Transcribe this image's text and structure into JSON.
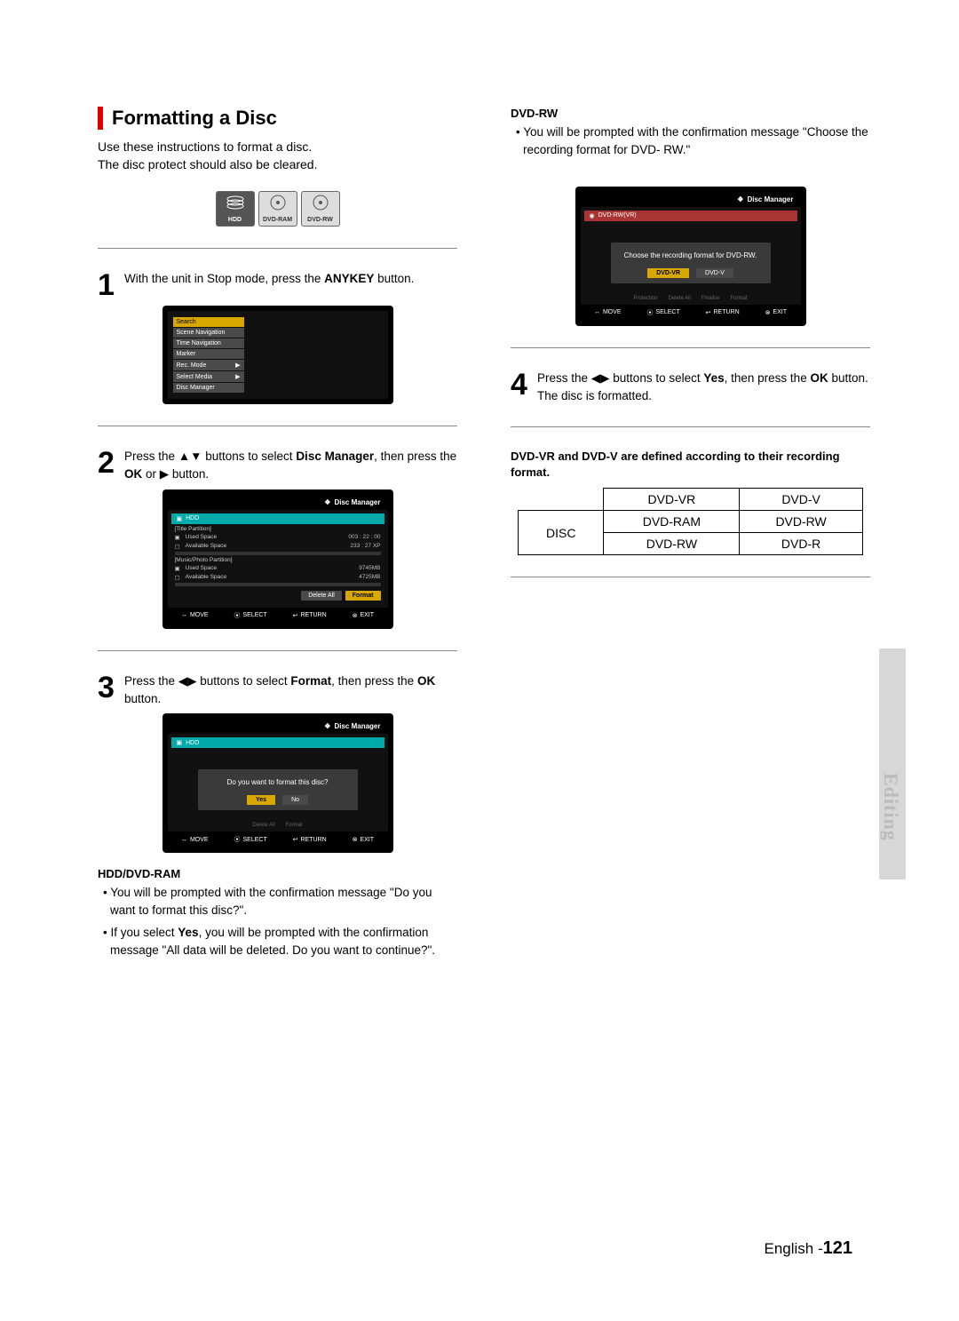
{
  "section_title": "Formatting a Disc",
  "intro_line1": "Use these instructions to format a disc.",
  "intro_line2": "The disc protect should also be cleared.",
  "badges": {
    "hdd": "HDD",
    "ram": "DVD-RAM",
    "rw": "DVD-RW"
  },
  "steps": {
    "s1": {
      "num": "1",
      "text_a": "With the unit in Stop mode, press the ",
      "bold": "ANYKEY",
      "text_b": " button."
    },
    "s2": {
      "num": "2",
      "text_a": "Press the ▲▼ buttons to select ",
      "bold1": "Disc Manager",
      "text_b": ", then press the ",
      "bold2": "OK",
      "text_c": " or ▶ button."
    },
    "s3": {
      "num": "3",
      "text_a": "Press the ◀▶ buttons to select ",
      "bold1": "Format",
      "text_b": ", then press the ",
      "bold2": "OK",
      "text_c": " button."
    },
    "s4": {
      "num": "4",
      "text_a": "Press the ◀▶ buttons to select ",
      "bold1": "Yes",
      "text_b": ", then press the ",
      "bold2": "OK",
      "text_c": " button. The disc is formatted."
    }
  },
  "osd1_menu": [
    "Search",
    "Scene Navigation",
    "Time Navigation",
    "Marker",
    "Rec. Mode",
    "Select Media",
    "Disc Manager"
  ],
  "osd1_hl": "Search",
  "osd_common": {
    "title": "Disc Manager",
    "bar_move": "MOVE",
    "bar_select": "SELECT",
    "bar_return": "RETURN",
    "bar_exit": "EXIT"
  },
  "osd2": {
    "device": "HDD",
    "title_partition": "[Title Partition]",
    "used_label": "Used Space",
    "used_val": "003 : 22 : 00",
    "avail_label": "Available Space",
    "avail_val": "233 : 27 XP",
    "music_partition": "[Music/Photo Partition]",
    "used2_val": "9745MB",
    "avail2_val": "4725MB",
    "btn_delete": "Delete All",
    "btn_format": "Format"
  },
  "osd3": {
    "device": "HDD",
    "modal_text": "Do you want to format this disc?",
    "yes": "Yes",
    "no": "No",
    "ghost_delete": "Delete All",
    "ghost_format": "Format"
  },
  "hdd_ram_head": "HDD/DVD-RAM",
  "hdd_ram_b1": "You will be prompted with the confirmation message \"Do you want to format this disc?\".",
  "hdd_ram_b2_a": "If you select ",
  "hdd_ram_b2_bold": "Yes",
  "hdd_ram_b2_b": ", you will be prompted with the confirmation message \"All data will be deleted. Do you want to continue?\".",
  "dvd_rw_head": "DVD-RW",
  "dvd_rw_b1": "You will be prompted with the confirmation message \"Choose the recording format for DVD- RW.\"",
  "osd4": {
    "device": "DVD-RW(VR)",
    "modal_text": "Choose the recording format for DVD-RW.",
    "vr": "DVD-VR",
    "v": "DVD-V",
    "ghost_protection": "Protection",
    "ghost_delete": "Delete All",
    "ghost_finalise": "Finalise",
    "ghost_format": "Format"
  },
  "format_note": "DVD-VR and DVD-V are defined according to their recording format.",
  "table": {
    "h1": "DVD-VR",
    "h2": "DVD-V",
    "row_label": "DISC",
    "r1c1": "DVD-RAM",
    "r1c2": "DVD-RW",
    "r2c1": "DVD-RW",
    "r2c2": "DVD-R"
  },
  "footer_lang": "English - ",
  "footer_page": "121",
  "side_tab": "Editing"
}
